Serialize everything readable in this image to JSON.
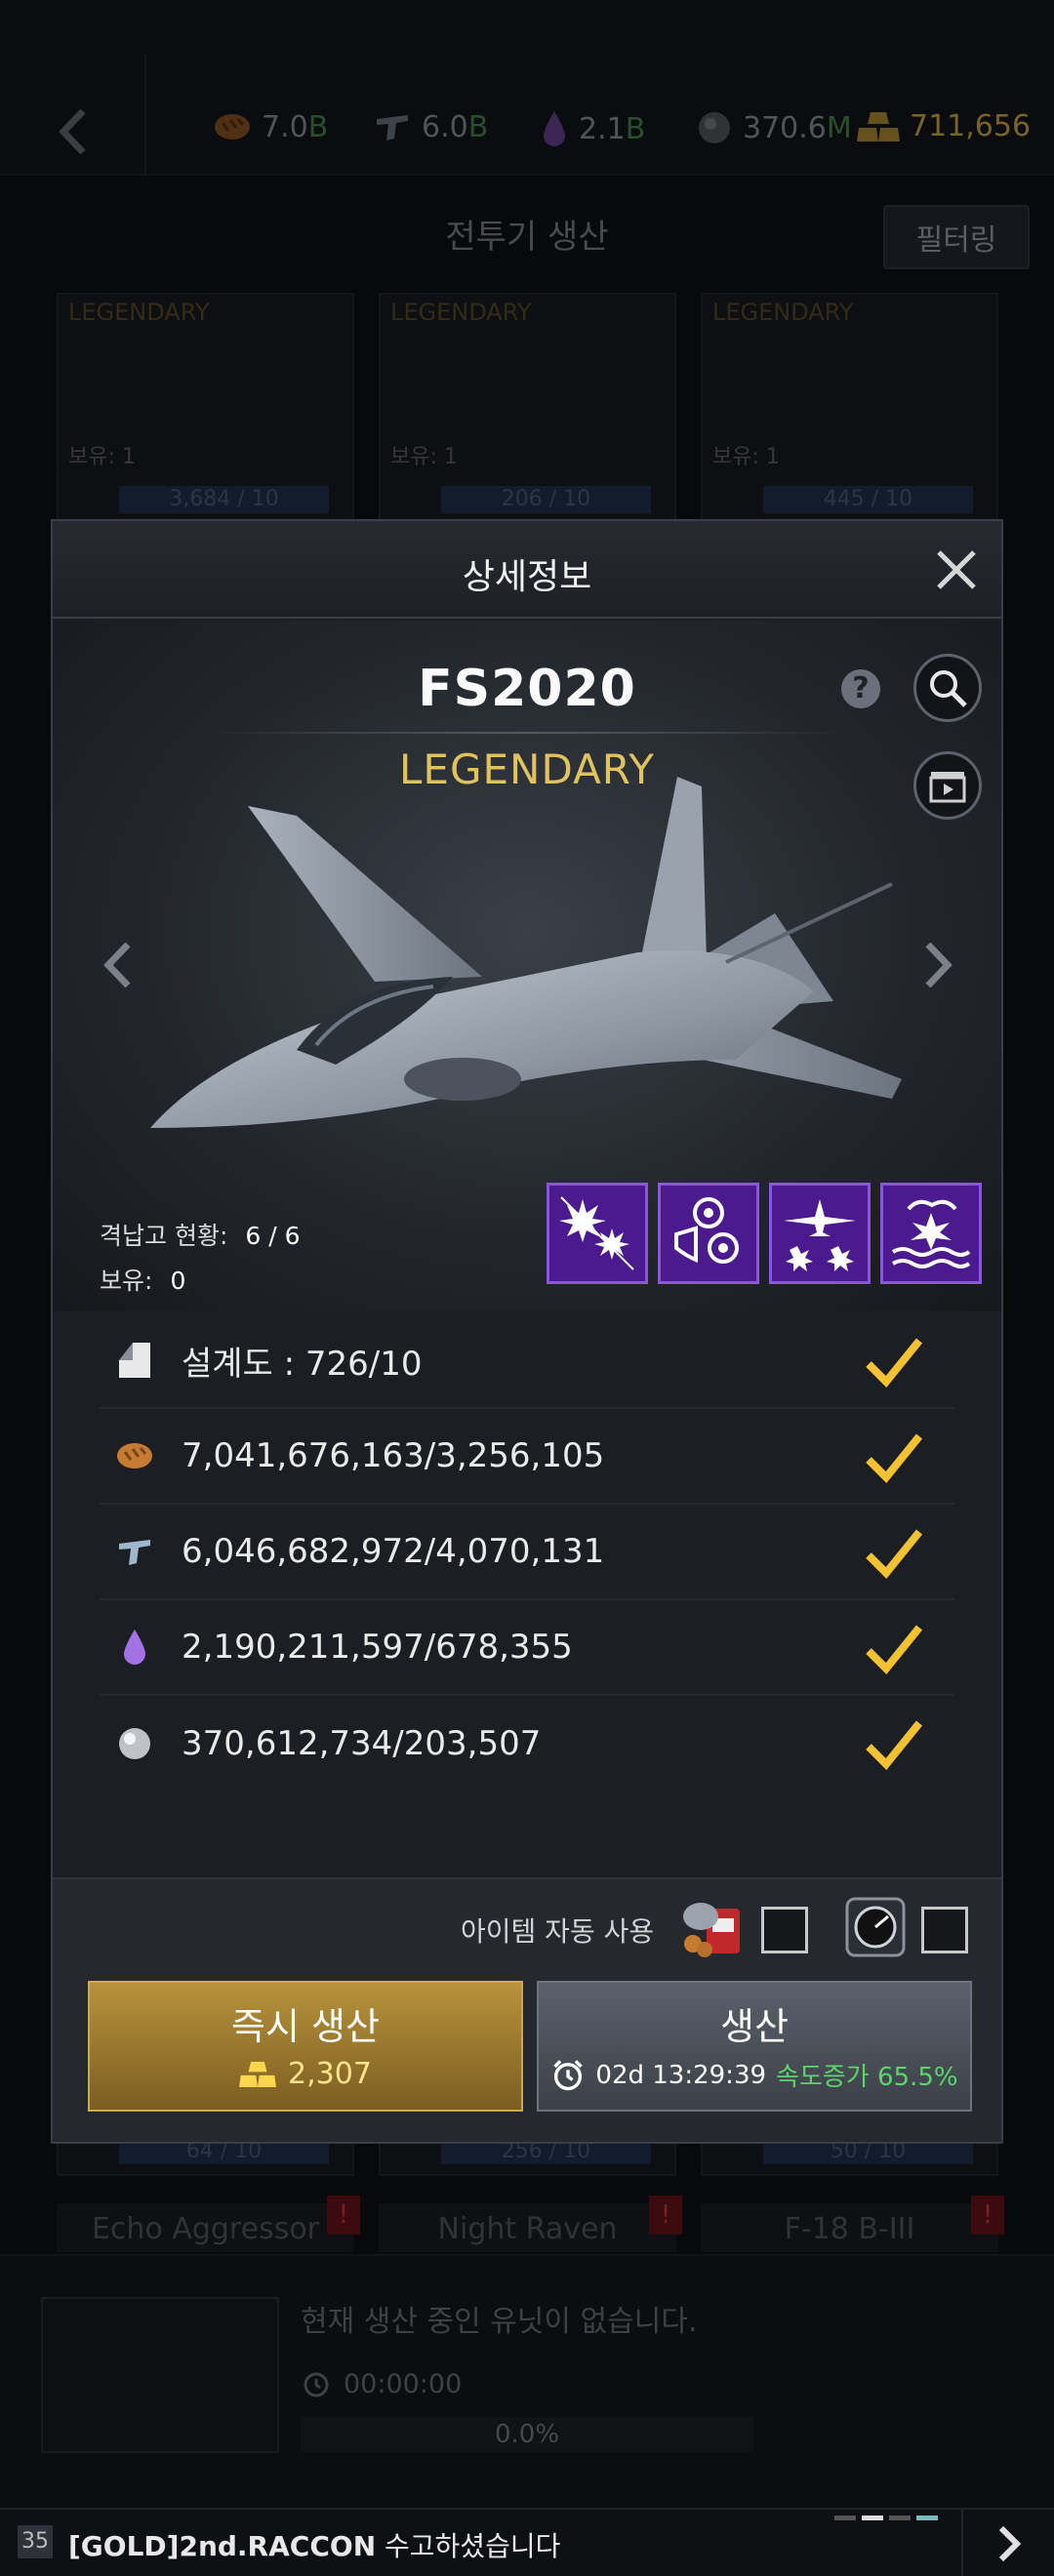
{
  "topbar": {
    "resources": [
      {
        "value": "7.0",
        "suffix": "B",
        "icon": "bread-icon"
      },
      {
        "value": "6.0",
        "suffix": "B",
        "icon": "steel-icon"
      },
      {
        "value": "2.1",
        "suffix": "B",
        "icon": "oil-drop-icon"
      },
      {
        "value": "370.6",
        "suffix": "M",
        "icon": "mineral-icon"
      },
      {
        "value": "711,656",
        "suffix": "",
        "icon": "gold-bars-icon"
      }
    ]
  },
  "page": {
    "title": "전투기 생산",
    "filter_label": "필터링"
  },
  "background_cards": [
    {
      "rarity": "LEGENDARY",
      "owned": "보유: 1",
      "progress": "3,684 / 10"
    },
    {
      "rarity": "LEGENDARY",
      "owned": "보유: 1",
      "progress": "206 / 10"
    },
    {
      "rarity": "LEGENDARY",
      "owned": "보유: 1",
      "progress": "445 / 10"
    }
  ],
  "background_cards_bottom": [
    {
      "progress": "64 / 10",
      "name": "Echo Aggressor"
    },
    {
      "progress": "256 / 10",
      "name": "Night Raven"
    },
    {
      "progress": "50 / 10",
      "name": "F-18 B-III"
    }
  ],
  "production": {
    "message": "현재 생산 중인 유닛이 없습니다.",
    "time": "00:00:00",
    "progress_label": "0.0%"
  },
  "chat": {
    "level": "35",
    "sender": "[GOLD]2nd.RACCON",
    "text": "수고하셨습니다"
  },
  "modal": {
    "title": "상세정보",
    "plane_name": "FS2020",
    "rarity": "LEGENDARY",
    "hangar_label": "격납고 현황:",
    "hangar_value": "6 / 6",
    "owned_label": "보유:",
    "owned_value": "0",
    "skills": [
      "skill-burst-icon",
      "skill-shield-icon",
      "skill-airstrike-icon",
      "skill-naval-icon"
    ],
    "requirements": [
      {
        "icon": "blueprint-icon",
        "text": "설계도 : 726/10",
        "met": true
      },
      {
        "icon": "bread-icon",
        "text": "7,041,676,163/3,256,105",
        "met": true
      },
      {
        "icon": "steel-icon",
        "text": "6,046,682,972/4,070,131",
        "met": true
      },
      {
        "icon": "oil-drop-icon",
        "text": "2,190,211,597/678,355",
        "met": true
      },
      {
        "icon": "mineral-icon",
        "text": "370,612,734/203,507",
        "met": true
      }
    ],
    "auto_item_label": "아이템 자동 사용",
    "instant_label": "즉시 생산",
    "instant_cost": "2,307",
    "produce_label": "생산",
    "produce_time": "02d 13:29:39",
    "produce_speed": "속도증가 65.5%",
    "colors": {
      "gold": "#e2c25d",
      "speed": "#58d66a",
      "check": "#f2c233",
      "skill": "#4b1a8f"
    }
  }
}
